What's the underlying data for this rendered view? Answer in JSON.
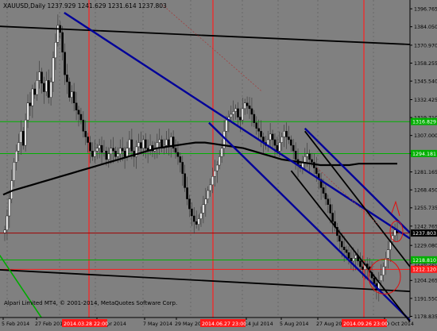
{
  "window": {
    "header": "XAUUSD,Daily  1237.929 1241.629 1231.614 1237.803",
    "footer": "Alpari Limited MT4, © 2001-2014, MetaQuotes Software Corp."
  },
  "colors": {
    "background": "#808080",
    "candle_body": "#000000",
    "candle_wick": "#3f3f3f",
    "sma": "#000000",
    "channel_blue": "#000099",
    "channel_black": "#000000",
    "level_green": "#00b000",
    "level_red": "#ff1a1a",
    "vline_red": "#ff2020",
    "date_highlight": "#ff1a1a"
  },
  "chart_data": {
    "type": "candlestick",
    "symbol": "XAUUSD",
    "timeframe": "Daily",
    "ohlc_header": {
      "open": 1237.929,
      "high": 1241.629,
      "low": 1231.614,
      "close": 1237.803
    },
    "ylim": [
      1178,
      1403
    ],
    "price_ticks": [
      "1396.765",
      "1384.050",
      "1370.970",
      "1358.255",
      "1345.540",
      "1332.425",
      "1319.710",
      "1307.000",
      "1294.285",
      "1281.165",
      "1268.450",
      "1255.735",
      "1242.765",
      "1229.080",
      "1216.320",
      "1204.265",
      "1191.550",
      "1178.835"
    ],
    "date_ticks": [
      "5 Feb 2014",
      "27 Feb 2014",
      "14 Apr 2014",
      "7 May 2014",
      "29 May 2014",
      "14 Jul 2014",
      "5 Aug 2014",
      "27 Aug 2014",
      "10 Oct 2014"
    ],
    "highlighted_dates": [
      "2014.03.28 22:00",
      "2014.06.27 23:00",
      "2014.09.26 23:00"
    ],
    "price_labels": [
      {
        "text": "1316.829",
        "price": 1316.829,
        "color": "#00b000"
      },
      {
        "text": "1294.181",
        "price": 1294.181,
        "color": "#00b000"
      },
      {
        "text": "1237.803",
        "price": 1237.803,
        "color": "#000000"
      },
      {
        "text": "1218.810",
        "price": 1218.81,
        "color": "#00b000"
      },
      {
        "text": "1212.120",
        "price": 1212.12,
        "color": "#ff1a1a"
      }
    ],
    "horizontal_levels": [
      {
        "price": 1316.829,
        "color": "#00b000"
      },
      {
        "price": 1294.181,
        "color": "#00b000"
      },
      {
        "price": 1237.803,
        "color": "#a00000"
      },
      {
        "price": 1218.81,
        "color": "#00b000"
      },
      {
        "price": 1212.12,
        "color": "#ff1a1a"
      }
    ],
    "close_path": [
      1240,
      1250,
      1262,
      1275,
      1288,
      1296,
      1302,
      1310,
      1300,
      1318,
      1330,
      1328,
      1340,
      1336,
      1346,
      1352,
      1344,
      1338,
      1346,
      1334,
      1345,
      1362,
      1373,
      1385,
      1380,
      1366,
      1350,
      1345,
      1334,
      1338,
      1330,
      1325,
      1322,
      1318,
      1310,
      1306,
      1302,
      1296,
      1292,
      1296,
      1298,
      1300,
      1295,
      1296,
      1290,
      1294,
      1298,
      1296,
      1292,
      1294,
      1298,
      1296,
      1292,
      1298,
      1304,
      1296,
      1292,
      1299,
      1302,
      1298,
      1304,
      1298,
      1296,
      1300,
      1296,
      1298,
      1302,
      1304,
      1298,
      1300,
      1304,
      1300,
      1306,
      1298,
      1295,
      1292,
      1288,
      1280,
      1270,
      1262,
      1255,
      1250,
      1246,
      1244,
      1248,
      1252,
      1258,
      1262,
      1268,
      1272,
      1278,
      1282,
      1286,
      1292,
      1298,
      1310,
      1318,
      1320,
      1322,
      1324,
      1326,
      1320,
      1318,
      1326,
      1330,
      1328,
      1326,
      1322,
      1316,
      1312,
      1310,
      1306,
      1302,
      1300,
      1304,
      1308,
      1304,
      1300,
      1296,
      1302,
      1306,
      1310,
      1306,
      1304,
      1300,
      1296,
      1290,
      1286,
      1284,
      1288,
      1292,
      1294,
      1290,
      1288,
      1284,
      1280,
      1276,
      1270,
      1266,
      1262,
      1258,
      1252,
      1246,
      1242,
      1236,
      1232,
      1228,
      1226,
      1224,
      1220,
      1218,
      1220,
      1222,
      1218,
      1214,
      1212,
      1216,
      1214,
      1210,
      1206,
      1202,
      1198,
      1204,
      1208,
      1214,
      1220,
      1226,
      1232,
      1236,
      1240,
      1238
    ],
    "sma_path": [
      1265,
      1268,
      1270,
      1272,
      1274,
      1276,
      1278,
      1280,
      1282,
      1284,
      1286,
      1288,
      1290,
      1292,
      1294,
      1296,
      1298,
      1299,
      1300,
      1301,
      1302,
      1302,
      1301,
      1300,
      1299,
      1298,
      1296,
      1294,
      1292,
      1290,
      1289,
      1288,
      1287,
      1286,
      1286,
      1286,
      1286,
      1287,
      1287,
      1287,
      1287,
      1287
    ],
    "lines": [
      {
        "type": "trend",
        "color": "#000000",
        "from": [
          "2014-01-20",
          1384.5
        ],
        "to": [
          "2014-10-20",
          1371.5
        ]
      },
      {
        "type": "trend",
        "color": "#000000",
        "from": [
          "2014-01-20",
          1212.0
        ],
        "to": [
          "2014-10-20",
          1196.5
        ]
      },
      {
        "type": "trend",
        "color": "#000099",
        "from": [
          "2014-03-07",
          1394.0
        ],
        "to": [
          "2014-10-20",
          1234.0
        ]
      },
      {
        "type": "trend",
        "color": "#000099",
        "from": [
          "2014-06-10",
          1316.0
        ],
        "to": [
          "2014-10-20",
          1176.0
        ]
      },
      {
        "type": "trend",
        "color": "#000099",
        "from": [
          "2014-08-12",
          1312.0
        ],
        "to": [
          "2014-10-20",
          1238.0
        ]
      },
      {
        "type": "trend",
        "color": "#000000",
        "from": [
          "2014-08-12",
          1310.0
        ],
        "to": [
          "2014-10-20",
          1214.0
        ]
      },
      {
        "type": "trend",
        "color": "#000000",
        "from": [
          "2014-08-03",
          1282.0
        ],
        "to": [
          "2014-10-20",
          1175.0
        ]
      },
      {
        "type": "trend",
        "color": "#00aa00",
        "from": [
          "2014-01-20",
          1228.0
        ],
        "to": [
          "2014-02-20",
          1178.0
        ]
      }
    ]
  }
}
